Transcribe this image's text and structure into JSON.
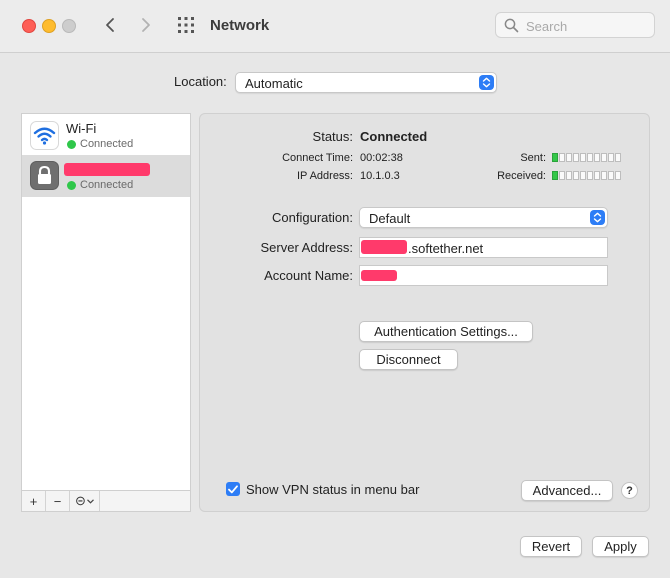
{
  "window": {
    "title": "Network"
  },
  "search": {
    "placeholder": "Search"
  },
  "location": {
    "label": "Location:",
    "value": "Automatic"
  },
  "services": [
    {
      "name": "Wi-Fi",
      "status": "Connected",
      "icon": "wifi-icon"
    },
    {
      "name": "",
      "status": "Connected",
      "icon": "lock-icon",
      "name_redacted": true
    }
  ],
  "sidebar_toolbar": {
    "add": "+",
    "remove": "−",
    "more": "⊝"
  },
  "status": {
    "label": "Status:",
    "value": "Connected",
    "connect_time_label": "Connect Time:",
    "connect_time": "00:02:38",
    "ip_label": "IP Address:",
    "ip": "10.1.0.3",
    "sent_label": "Sent:",
    "received_label": "Received:",
    "sent_level": 0.1,
    "received_level": 0.1
  },
  "configuration": {
    "label": "Configuration:",
    "value": "Default"
  },
  "server": {
    "label": "Server Address:",
    "value_suffix": ".softether.net"
  },
  "account": {
    "label": "Account Name:"
  },
  "buttons": {
    "auth": "Authentication Settings...",
    "disconnect": "Disconnect",
    "advanced": "Advanced...",
    "help": "?",
    "revert": "Revert",
    "apply": "Apply"
  },
  "show_vpn": {
    "label": "Show VPN status in menu bar",
    "checked": true
  },
  "colors": {
    "accent": "#2d7df6",
    "connected": "#2fc74a",
    "redaction": "#ff3a6b"
  }
}
